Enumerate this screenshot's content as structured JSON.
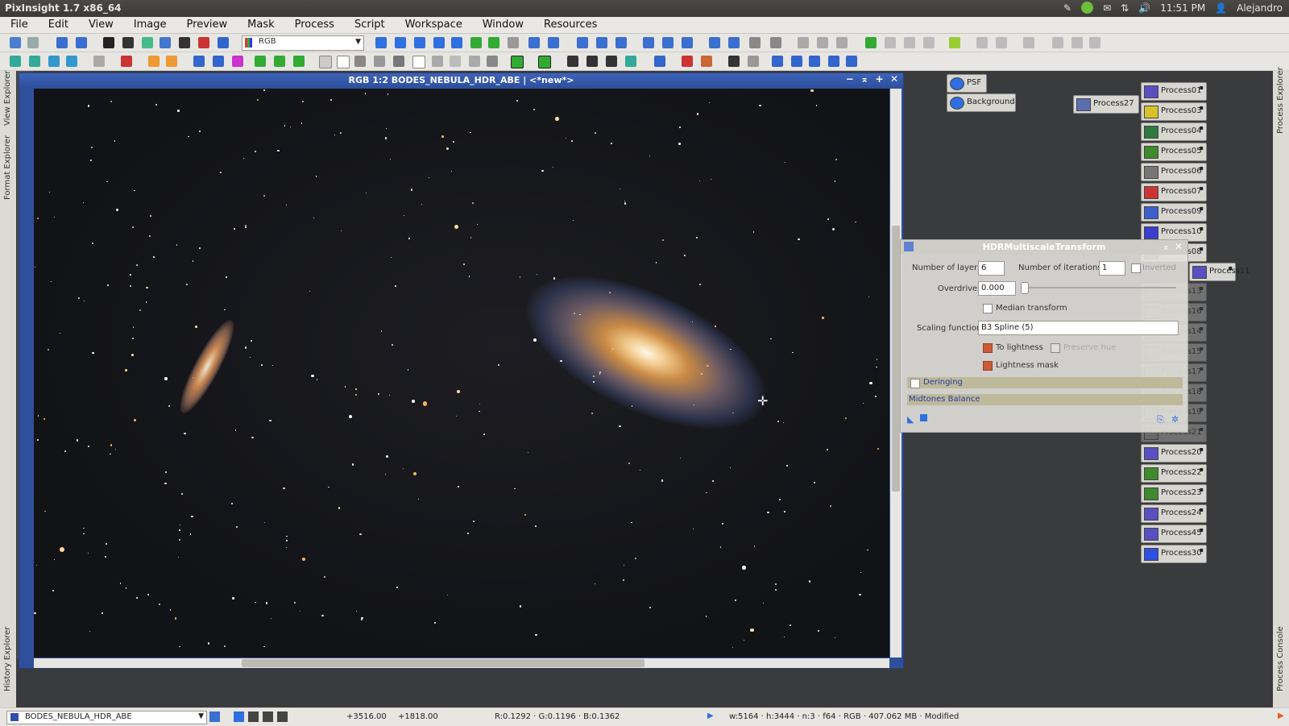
{
  "app": {
    "title": "PixInsight 1.7 x86_64"
  },
  "tray": {
    "time": "11:51 PM",
    "user": "Alejandro"
  },
  "menu": [
    "File",
    "Edit",
    "View",
    "Image",
    "Preview",
    "Mask",
    "Process",
    "Script",
    "Workspace",
    "Window",
    "Resources"
  ],
  "toolbar": {
    "color_mode": "RGB"
  },
  "left_tabs": {
    "view_explorer": "View Explorer",
    "format_explorer": "Format Explorer",
    "history_explorer": "History Explorer",
    "image_id": "BODES_NEBULA_HDR_ABE"
  },
  "right_tabs": {
    "process_explorer": "Process Explorer",
    "process_console": "Process Console"
  },
  "image_window": {
    "title": "RGB 1:2 BODES_NEBULA_HDR_ABE | <*new*>"
  },
  "icons_top": [
    "PSF",
    "Background",
    "Process27"
  ],
  "process_icons": [
    "Process01",
    "Process03",
    "Process04",
    "Process05",
    "Process06",
    "Process07",
    "Process09",
    "Process10",
    "Process08",
    "Process11",
    "Process13",
    "Process16",
    "Process14",
    "Process15",
    "Process17",
    "Process18",
    "Process19",
    "Process21",
    "Process20",
    "Process22",
    "Process23",
    "Process24",
    "Process45",
    "Process30"
  ],
  "hdr_dialog": {
    "title": "HDRMultiscaleTransform",
    "layers_label": "Number of layers:",
    "layers_value": "6",
    "iterations_label": "Number of iterations:",
    "iterations_value": "1",
    "inverted": "Inverted",
    "overdrive_label": "Overdrive:",
    "overdrive_value": "0.000",
    "median_label": "Median transform",
    "scaling_label": "Scaling function:",
    "scaling_value": "B3 Spline (5)",
    "to_lightness": "To lightness",
    "preserve_hue": "Preserve hue",
    "lightness_mask": "Lightness mask",
    "deringing": "Deringing",
    "midtones": "Midtones Balance"
  },
  "statusbar": {
    "view": "BODES_NEBULA_HDR_ABE",
    "x": "+3516.00",
    "y": "+1818.00",
    "rgb": "R:0.1292 · G:0.1196 · B:0.1362",
    "info": "w:5164 · h:3444 · n:3 · f64 · RGB · 407.062 MB · Modified"
  }
}
